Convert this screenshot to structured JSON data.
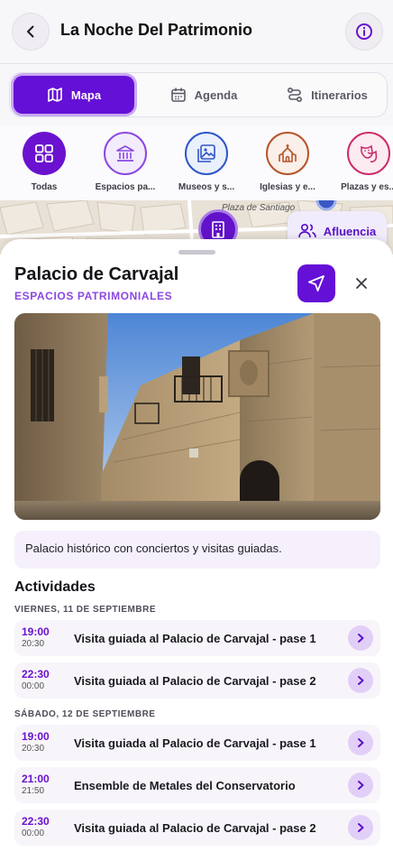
{
  "header": {
    "title": "La Noche Del Patrimonio",
    "back_icon": "chevron-left-icon",
    "info_icon": "info-icon"
  },
  "tabs": [
    {
      "label": "Mapa",
      "icon": "map-icon",
      "active": true
    },
    {
      "label": "Agenda",
      "icon": "calendar-icon",
      "active": false
    },
    {
      "label": "Itinerarios",
      "icon": "route-icon",
      "active": false
    }
  ],
  "categories": [
    {
      "label": "Todas",
      "icon": "grid-icon",
      "color": "#6a12cf",
      "active": true
    },
    {
      "label": "Espacios pa...",
      "icon": "museum-building-icon",
      "color": "#8b48e0",
      "active": false
    },
    {
      "label": "Museos y s...",
      "icon": "image-gallery-icon",
      "color": "#2f56c9",
      "active": false
    },
    {
      "label": "Iglesias y e...",
      "icon": "church-icon",
      "color": "#b6552a",
      "active": false
    },
    {
      "label": "Plazas y es...",
      "icon": "theater-masks-icon",
      "color": "#cc2d6e",
      "active": false
    }
  ],
  "map": {
    "street_label": "Plaza de Santiago",
    "afluencia_label": "Afluencia"
  },
  "place": {
    "name": "Palacio de Carvajal",
    "category": "ESPACIOS PATRIMONIALES",
    "description": "Palacio histórico con conciertos y visitas guiadas."
  },
  "activities": {
    "title": "Actividades",
    "days": [
      {
        "label": "VIERNES, 11 DE SEPTIEMBRE",
        "items": [
          {
            "start": "19:00",
            "end": "20:30",
            "name": "Visita guiada al Palacio de Carvajal - pase 1"
          },
          {
            "start": "22:30",
            "end": "00:00",
            "name": "Visita guiada al Palacio de Carvajal - pase 2"
          }
        ]
      },
      {
        "label": "SÁBADO, 12 DE SEPTIEMBRE",
        "items": [
          {
            "start": "19:00",
            "end": "20:30",
            "name": "Visita guiada al Palacio de Carvajal - pase 1"
          },
          {
            "start": "21:00",
            "end": "21:50",
            "name": "Ensemble de Metales del Conservatorio"
          },
          {
            "start": "22:30",
            "end": "00:00",
            "name": "Visita guiada al Palacio de Carvajal - pase 2"
          }
        ]
      }
    ]
  },
  "colors": {
    "accent": "#6510d6",
    "accent_light": "#8b48e0",
    "surface_tint": "#f5f0fc"
  }
}
